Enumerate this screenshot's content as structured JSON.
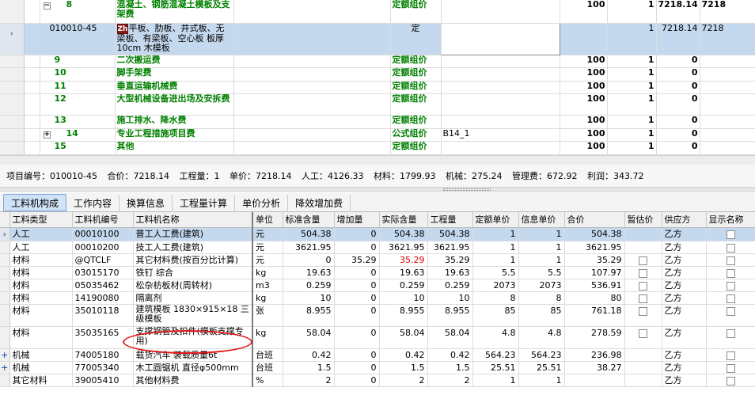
{
  "top_rows": [
    {
      "code": "8",
      "name": "混凝土、钢筋混凝土模板及支架费",
      "type": "定额组价",
      "formula": "",
      "rate": "100",
      "qty": "1",
      "unit_price": "7218.14",
      "total": "7218",
      "expand": "−"
    },
    {
      "code": "010010-45",
      "name": "平板、肋板、井式板、无梁板、有梁板、空心板 板厚10cm 木模板",
      "type": "定",
      "formula": "",
      "rate": "",
      "qty": "1",
      "unit_price": "7218.14",
      "total": "7218"
    },
    {
      "code": "9",
      "name": "二次搬运费",
      "type": "定额组价",
      "formula": "",
      "rate": "100",
      "qty": "1",
      "unit_price": "0",
      "total": ""
    },
    {
      "code": "10",
      "name": "脚手架费",
      "type": "定额组价",
      "formula": "",
      "rate": "100",
      "qty": "1",
      "unit_price": "0",
      "total": ""
    },
    {
      "code": "11",
      "name": "垂直运输机械费",
      "type": "定额组价",
      "formula": "",
      "rate": "100",
      "qty": "1",
      "unit_price": "0",
      "total": ""
    },
    {
      "code": "12",
      "name": "大型机械设备进出场及安拆费",
      "type": "定额组价",
      "formula": "",
      "rate": "100",
      "qty": "1",
      "unit_price": "0",
      "total": ""
    },
    {
      "code": "13",
      "name": "施工排水、降水费",
      "type": "定额组价",
      "formula": "",
      "rate": "100",
      "qty": "1",
      "unit_price": "0",
      "total": ""
    },
    {
      "code": "14",
      "name": "专业工程措施项目费",
      "type": "公式组价",
      "formula": "B14_1",
      "rate": "100",
      "qty": "1",
      "unit_price": "0",
      "total": "",
      "expand": "+"
    },
    {
      "code": "15",
      "name": "其他",
      "type": "定额组价",
      "formula": "",
      "rate": "100",
      "qty": "1",
      "unit_price": "0",
      "total": ""
    }
  ],
  "row_pointer": "›",
  "quota_icon": "Zh",
  "status": {
    "code": "项目编号：010010-45",
    "total": "合价：7218.14",
    "qty": "工程量：1",
    "unit_price": "单价：7218.14",
    "labor": "人工：4126.33",
    "material": "材料：1799.93",
    "machine": "机械：275.24",
    "mgmt": "管理费：672.92",
    "profit": "利润：343.72"
  },
  "tabs": [
    "工料机构成",
    "工作内容",
    "换算信息",
    "工程量计算",
    "单价分析",
    "降效增加费"
  ],
  "columns": [
    "工料类型",
    "工料机编号",
    "工料机名称",
    "单位",
    "标准含量",
    "增加量",
    "实际含量",
    "工程量",
    "定额单价",
    "信息单价",
    "合价",
    "暂估价",
    "供应方",
    "显示名称"
  ],
  "materials": [
    {
      "kind": "人工",
      "code": "00010100",
      "name": "普工人工费(建筑)",
      "unit": "元",
      "std": "504.38",
      "add": "0",
      "actual": "504.38",
      "qty": "504.38",
      "quota_price": "1",
      "info_price": "1",
      "total": "504.38",
      "supplier": "乙方",
      "lead": "›"
    },
    {
      "kind": "人工",
      "code": "00010200",
      "name": "技工人工费(建筑)",
      "unit": "元",
      "std": "3621.95",
      "add": "0",
      "actual": "3621.95",
      "qty": "3621.95",
      "quota_price": "1",
      "info_price": "1",
      "total": "3621.95",
      "supplier": "乙方"
    },
    {
      "kind": "材料",
      "code": "@QTCLF",
      "name": "其它材料费(按百分比计算)",
      "unit": "元",
      "std": "0",
      "add": "35.29",
      "actual": "35.29",
      "qty": "35.29",
      "quota_price": "1",
      "info_price": "1",
      "total": "35.29",
      "supplier": "乙方",
      "red": true
    },
    {
      "kind": "材料",
      "code": "03015170",
      "name": "铁钉 综合",
      "unit": "kg",
      "std": "19.63",
      "add": "0",
      "actual": "19.63",
      "qty": "19.63",
      "quota_price": "5.5",
      "info_price": "5.5",
      "total": "107.97",
      "supplier": "乙方"
    },
    {
      "kind": "材料",
      "code": "05035462",
      "name": "松杂枋板材(周转材)",
      "unit": "m3",
      "std": "0.259",
      "add": "0",
      "actual": "0.259",
      "qty": "0.259",
      "quota_price": "2073",
      "info_price": "2073",
      "total": "536.91",
      "supplier": "乙方"
    },
    {
      "kind": "材料",
      "code": "14190080",
      "name": "隔离剂",
      "unit": "kg",
      "std": "10",
      "add": "0",
      "actual": "10",
      "qty": "10",
      "quota_price": "8",
      "info_price": "8",
      "total": "80",
      "supplier": "乙方"
    },
    {
      "kind": "材料",
      "code": "35010118",
      "name": "建筑模板 1830×915×18 三级模板",
      "unit": "张",
      "std": "8.955",
      "add": "0",
      "actual": "8.955",
      "qty": "8.955",
      "quota_price": "85",
      "info_price": "85",
      "total": "761.18",
      "supplier": "乙方",
      "tall": true
    },
    {
      "kind": "材料",
      "code": "35035165",
      "name": "支撑钢管及扣件(模板支撑专用)",
      "unit": "kg",
      "std": "58.04",
      "add": "0",
      "actual": "58.04",
      "qty": "58.04",
      "quota_price": "4.8",
      "info_price": "4.8",
      "total": "278.59",
      "supplier": "乙方",
      "tall": true
    },
    {
      "kind": "机械",
      "code": "74005180",
      "name": "载货汽车 装载质量6t",
      "unit": "台班",
      "std": "0.42",
      "add": "0",
      "actual": "0.42",
      "qty": "0.42",
      "quota_price": "564.23",
      "info_price": "564.23",
      "total": "236.98",
      "supplier": "乙方",
      "lead": "+"
    },
    {
      "kind": "机械",
      "code": "77005340",
      "name": "木工圆锯机 直径φ500mm",
      "unit": "台班",
      "std": "1.5",
      "add": "0",
      "actual": "1.5",
      "qty": "1.5",
      "quota_price": "25.51",
      "info_price": "25.51",
      "total": "38.27",
      "supplier": "乙方",
      "lead": "+"
    },
    {
      "kind": "其它材料",
      "code": "39005410",
      "name": "其他材料费",
      "unit": "%",
      "std": "2",
      "add": "0",
      "actual": "2",
      "qty": "2",
      "quota_price": "1",
      "info_price": "1",
      "total": "",
      "supplier": "乙方"
    }
  ]
}
